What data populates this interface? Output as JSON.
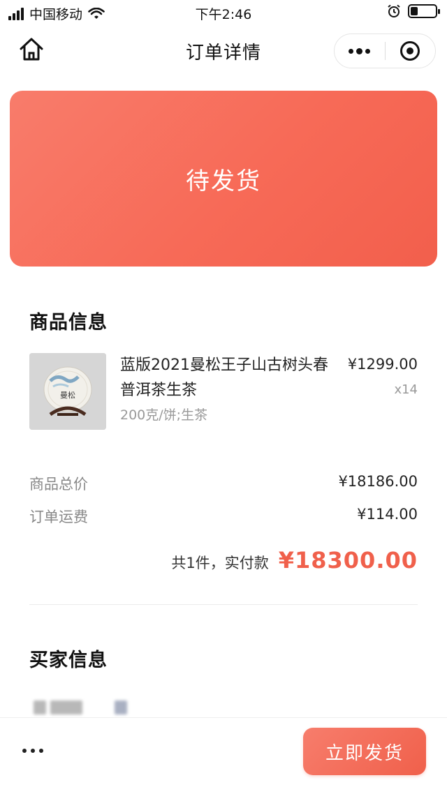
{
  "status_bar": {
    "carrier": "中国移动",
    "time": "下午2:46",
    "battery_level": 0.3
  },
  "nav": {
    "title": "订单详情",
    "icons": [
      "home-icon",
      "more-dots-icon",
      "target-icon"
    ]
  },
  "order_status": {
    "text": "待发货",
    "color": "#f76a57"
  },
  "goods": {
    "section_title": "商品信息",
    "items": [
      {
        "name": "蓝版2021曼松王子山古树头春普洱茶生茶",
        "spec": "200克/饼;生茶",
        "price": "¥1299.00",
        "quantity": "x14",
        "thumb_label": "曼松"
      }
    ],
    "total_label": "商品总价",
    "total_value": "¥18186.00",
    "shipping_label": "订单运费",
    "shipping_value": "¥114.00",
    "paid_label": "共1件，实付款",
    "paid_value": "¥18300.00"
  },
  "buyer": {
    "section_title": "买家信息"
  },
  "bottom_bar": {
    "action_label": "立即发货",
    "accent": "#f0604b"
  }
}
